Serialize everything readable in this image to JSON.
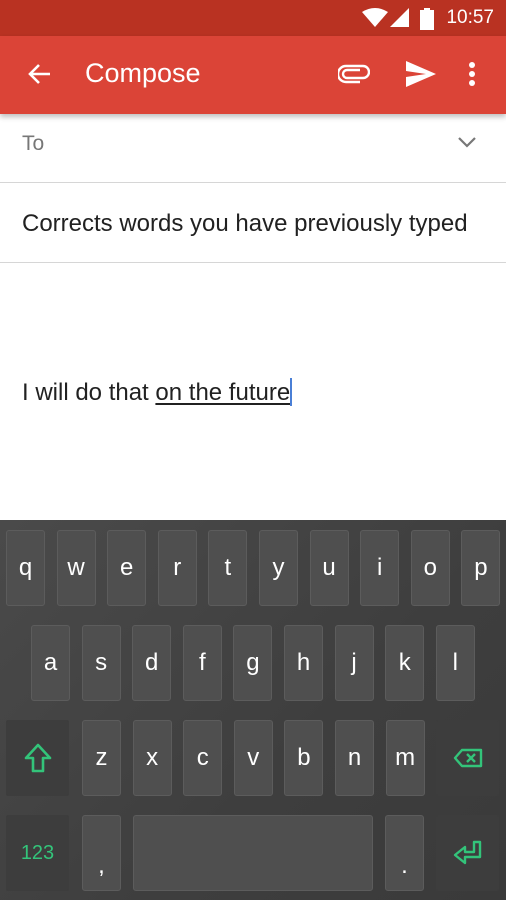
{
  "status_bar": {
    "time": "10:57",
    "icons": [
      "wifi-icon",
      "signal-icon",
      "battery-icon"
    ]
  },
  "app_bar": {
    "title": "Compose",
    "icons": [
      "back-arrow-icon",
      "attach-icon",
      "send-icon",
      "more-vert-icon"
    ]
  },
  "compose": {
    "to_label": "To",
    "subject": "Corrects words you have previously typed",
    "body_prefix": "I will do that ",
    "body_suggestion": "on the future"
  },
  "keyboard": {
    "accent_color": "#33c47a",
    "row1": [
      "q",
      "w",
      "e",
      "r",
      "t",
      "y",
      "u",
      "i",
      "o",
      "p"
    ],
    "row2": [
      "a",
      "s",
      "d",
      "f",
      "g",
      "h",
      "j",
      "k",
      "l"
    ],
    "row3": [
      "z",
      "x",
      "c",
      "v",
      "b",
      "n",
      "m"
    ],
    "numbers_label": "123",
    "comma": ",",
    "period": "."
  }
}
